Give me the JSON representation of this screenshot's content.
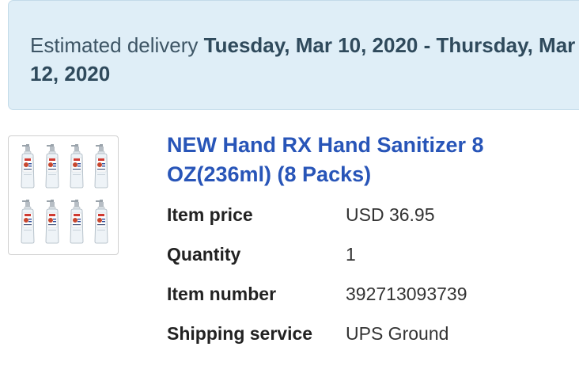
{
  "delivery": {
    "prefix": "Estimated delivery",
    "dates": "Tuesday, Mar 10, 2020 - Thursday, Mar 12, 2020"
  },
  "product": {
    "title": "NEW Hand RX Hand Sanitizer 8 OZ(236ml) (8 Packs)",
    "image_icon": "hand-sanitizer-bottles-image"
  },
  "details": [
    {
      "label": "Item price",
      "value": "USD 36.95"
    },
    {
      "label": "Quantity",
      "value": "1"
    },
    {
      "label": "Item number",
      "value": "392713093739"
    },
    {
      "label": "Shipping service",
      "value": "UPS Ground"
    }
  ],
  "colors": {
    "banner_bg": "#dfeef7",
    "link": "#2855b8"
  }
}
